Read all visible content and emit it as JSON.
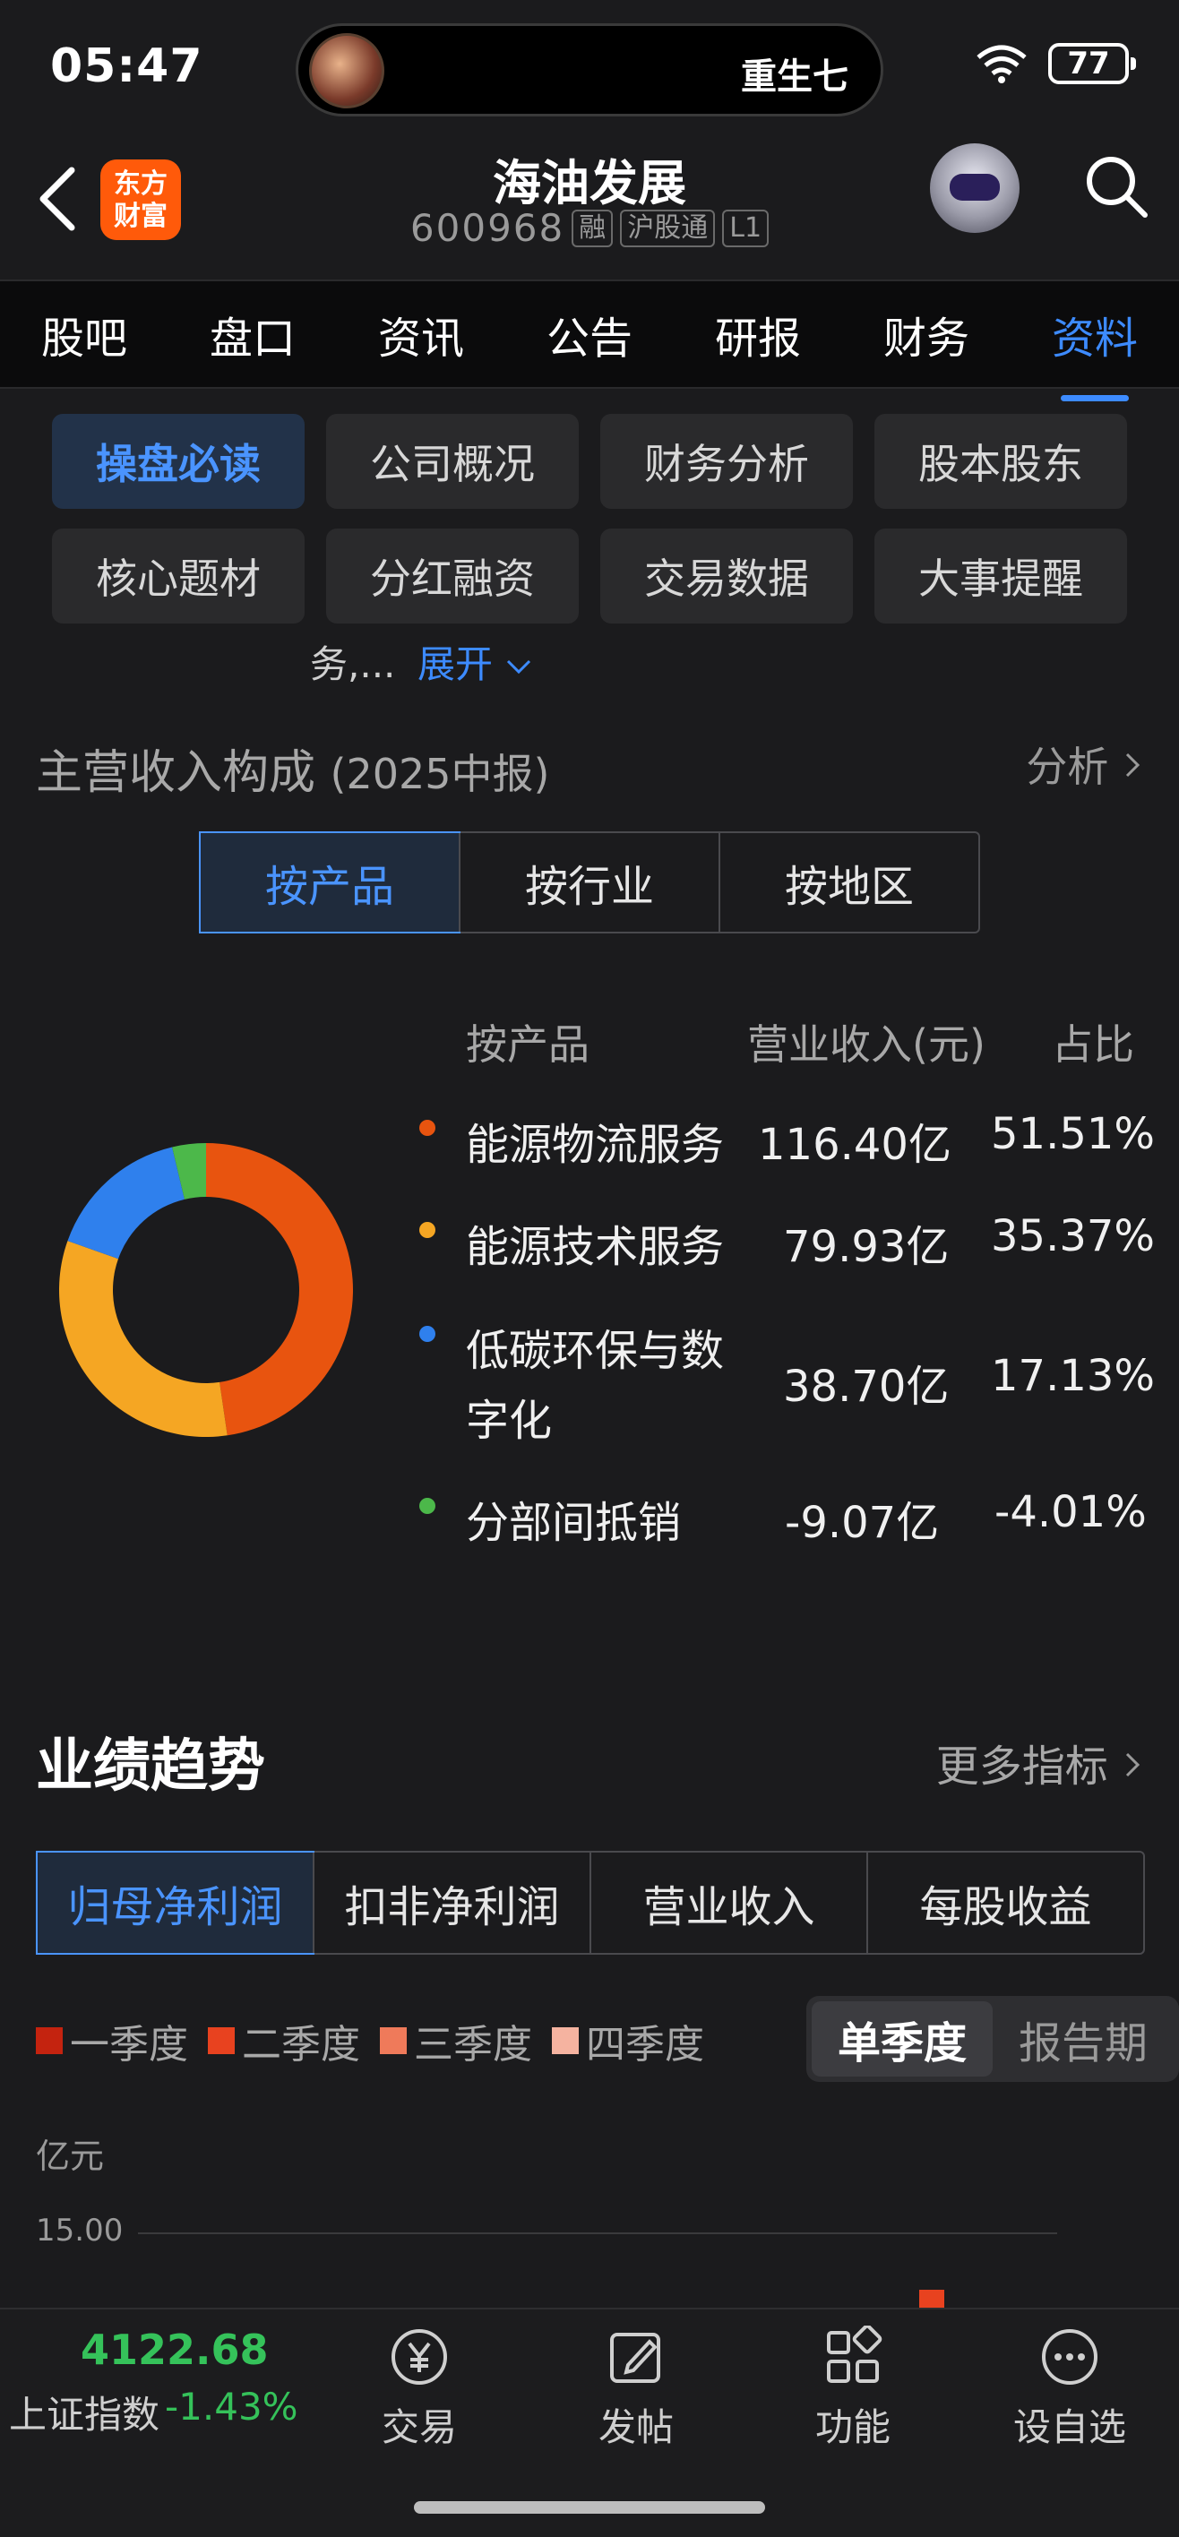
{
  "status": {
    "time": "05:47",
    "island_text": "重生七",
    "battery": "77"
  },
  "header": {
    "logo_line1": "东方",
    "logo_line2": "财富",
    "title": "海油发展",
    "code": "600968",
    "tags": [
      "融",
      "沪股通",
      "L1"
    ]
  },
  "tabs": [
    {
      "label": "股吧"
    },
    {
      "label": "盘口"
    },
    {
      "label": "资讯"
    },
    {
      "label": "公告"
    },
    {
      "label": "研报"
    },
    {
      "label": "财务"
    },
    {
      "label": "资料"
    }
  ],
  "chips": [
    {
      "label": "操盘必读"
    },
    {
      "label": "公司概况"
    },
    {
      "label": "财务分析"
    },
    {
      "label": "股本股东"
    },
    {
      "label": "核心题材"
    },
    {
      "label": "分红融资"
    },
    {
      "label": "交易数据"
    },
    {
      "label": "大事提醒"
    }
  ],
  "peek": {
    "text": "务,...",
    "expand": "展开"
  },
  "revenue": {
    "title": "主营收入构成",
    "period": "(2025中报)",
    "analyze": "分析",
    "segments": [
      "按产品",
      "按行业",
      "按地区"
    ],
    "headers": {
      "name": "按产品",
      "amount": "营业收入(元)",
      "ratio": "占比"
    },
    "rows": [
      {
        "name": "能源物流服务",
        "amount": "116.40亿",
        "ratio": "51.51%",
        "color": "#e8540f"
      },
      {
        "name": "能源技术服务",
        "amount": "79.93亿",
        "ratio": "35.37%",
        "color": "#f5a623"
      },
      {
        "name": "低碳环保与数字化",
        "name_l1": "低碳环保与数",
        "name_l2": "字化",
        "amount": "38.70亿",
        "ratio": "17.13%",
        "color": "#2f80ed"
      },
      {
        "name": "分部间抵销",
        "amount": "-9.07亿",
        "ratio": "-4.01%",
        "color": "#4cb84a"
      }
    ]
  },
  "performance": {
    "title": "业绩趋势",
    "more": "更多指标",
    "tabs": [
      "归母净利润",
      "扣非净利润",
      "营业收入",
      "每股收益"
    ],
    "legend": [
      {
        "label": "一季度",
        "color": "#c4230f"
      },
      {
        "label": "二季度",
        "color": "#e8421f"
      },
      {
        "label": "三季度",
        "color": "#ef7a5a"
      },
      {
        "label": "四季度",
        "color": "#f5b3a0"
      }
    ],
    "period_toggle": [
      "单季度",
      "报告期"
    ],
    "unit": "亿元",
    "ytick": "15.00"
  },
  "bottom": {
    "index_value": "4122.68",
    "index_name": "上证指数",
    "index_change": "-1.43%",
    "nav": [
      {
        "label": "交易"
      },
      {
        "label": "发帖"
      },
      {
        "label": "功能"
      },
      {
        "label": "设自选"
      }
    ]
  }
}
